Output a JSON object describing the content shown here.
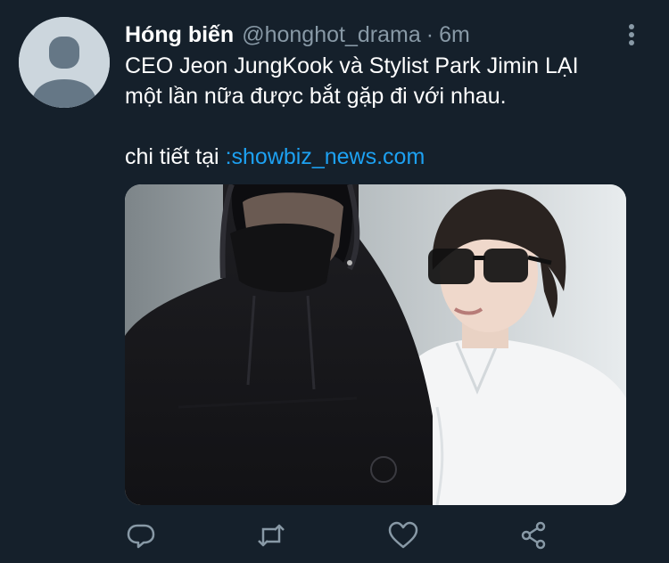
{
  "tweet": {
    "author": {
      "display_name": "Hóng biến",
      "handle": "@honghot_drama",
      "avatar_icon": "default-avatar-icon"
    },
    "separator": "·",
    "timestamp": "6m",
    "text": {
      "line1": "CEO Jeon JungKook và Stylist Park Jimin LẠI",
      "line2": "một lần nữa được bắt gặp đi với nhau.",
      "detail_prefix": "chi tiết tại ",
      "link": ":showbiz_news.com"
    },
    "media": {
      "type": "photo"
    },
    "actions": [
      {
        "name": "reply",
        "icon": "reply-icon"
      },
      {
        "name": "retweet",
        "icon": "retweet-icon"
      },
      {
        "name": "like",
        "icon": "heart-icon"
      },
      {
        "name": "share",
        "icon": "share-icon"
      }
    ],
    "more_icon": "more-vertical-icon"
  },
  "colors": {
    "background": "#15202b",
    "text_primary": "#ffffff",
    "text_secondary": "#8899a6",
    "link": "#1da1f2",
    "avatar_bg": "#ccd6dd",
    "avatar_fg": "#657786"
  }
}
